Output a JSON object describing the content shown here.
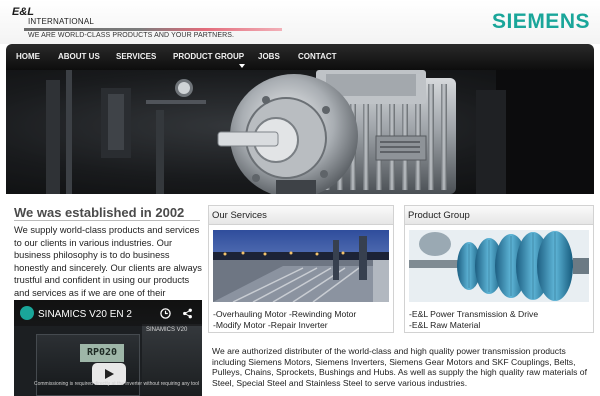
{
  "header": {
    "logo_mark": "E&L",
    "logo_sub": "INTERNATIONAL",
    "tagline": "WE ARE WORLD-CLASS PRODUCTS AND YOUR PARTNERS.",
    "brand": "SIEMENS"
  },
  "nav": {
    "items": [
      "HOME",
      "ABOUT US",
      "SERVICES",
      "PRODUCT GROUP",
      "JOBS",
      "CONTACT"
    ]
  },
  "intro": {
    "title": "We was established in 2002",
    "text": "We supply world-class products and services to our clients in various industries. Our business philosophy is to do business honestly and sincerely. Our clients are always trustful and confident in using our products and services as if we are one of their partners."
  },
  "video": {
    "title": "SINAMICS V20 EN 2",
    "screen_value": "RP020",
    "side_label": "SINAMICS V20",
    "caption": "Commissioning is required directly at the inverter without requiring any tool"
  },
  "services": {
    "title": "Our Services",
    "lines": [
      "-Overhauling Motor -Rewinding Motor",
      "-Modify Motor -Repair Inverter"
    ]
  },
  "products": {
    "title": "Product Group",
    "lines": [
      "-E&L Power Transmission & Drive",
      "-E&L Raw Material"
    ]
  },
  "about": "We are authorized distributer of the world-class and high quality power transmission products including Siemens Motors, Siemens Inverters, Siemens Gear Motors and SKF Couplings, Belts, Pulleys, Chains, Sprockets, Bushings and Hubs. As well as supply the high quality raw materials of Steel, Special Steel and Stainless Steel to serve various industries.",
  "colors": {
    "brand": "#1aa69a",
    "nav_bg": "#111111",
    "logo_accent": "#e26b7a"
  }
}
